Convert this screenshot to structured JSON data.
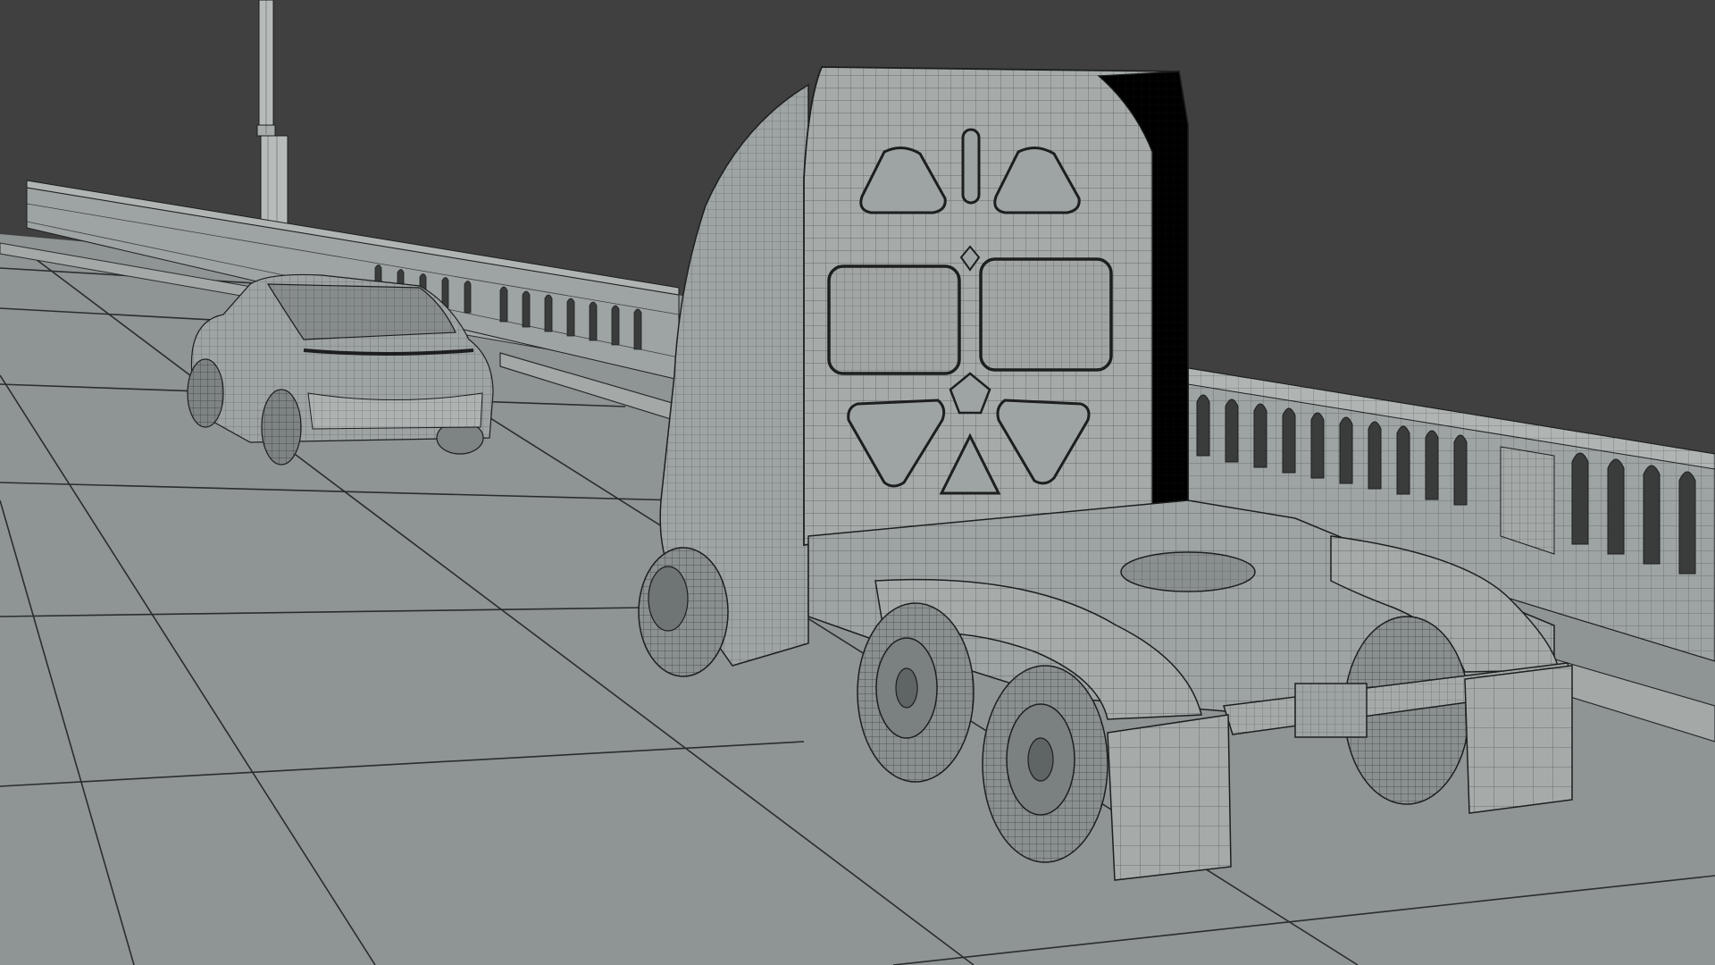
{
  "scene": {
    "kind": "3d-viewport-wireframe-render",
    "render_style": "shaded-with-wireframe",
    "objects": [
      "semi-truck-tractor-cab",
      "compact-suv",
      "bridge-deck-road",
      "bridge-railing-left",
      "bridge-railing-right",
      "lamp-post"
    ]
  },
  "colors": {
    "background": "#404040",
    "ground": "#8f9494",
    "ground_lines": "#2a2d2d",
    "model_fill": "#9ea3a3",
    "model_fill_light": "#aeb3b2",
    "model_fill_dark": "#7e8383",
    "wire": "#1d1f1f",
    "lamp_post": "#b7bcbb"
  }
}
